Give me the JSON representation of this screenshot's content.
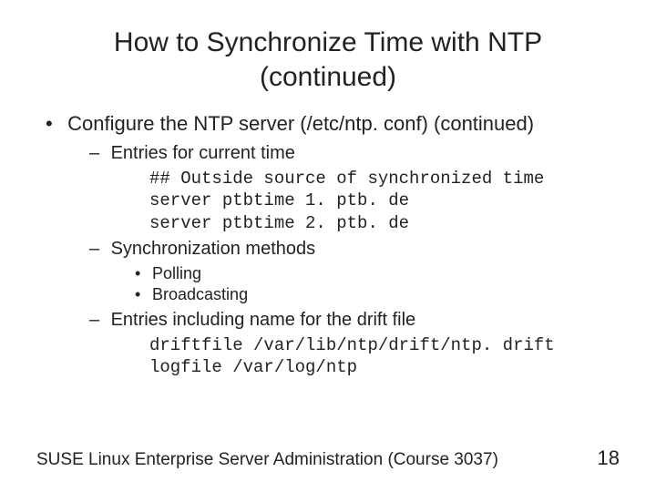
{
  "title_line1": "How to Synchronize Time with NTP",
  "title_line2": "(continued)",
  "l1_item": "Configure the NTP server (/etc/ntp. conf) (continued)",
  "l2_a": "Entries for current time",
  "code_a": [
    "## Outside source of synchronized time",
    "server ptbtime 1. ptb. de",
    "server ptbtime 2. ptb. de"
  ],
  "l2_b": "Synchronization methods",
  "l3_b1": "Polling",
  "l3_b2": "Broadcasting",
  "l2_c": "Entries including name for the drift file",
  "code_c": [
    "driftfile /var/lib/ntp/drift/ntp. drift",
    "logfile /var/log/ntp"
  ],
  "footer_text": "SUSE Linux Enterprise Server Administration (Course 3037)",
  "page_number": "18"
}
